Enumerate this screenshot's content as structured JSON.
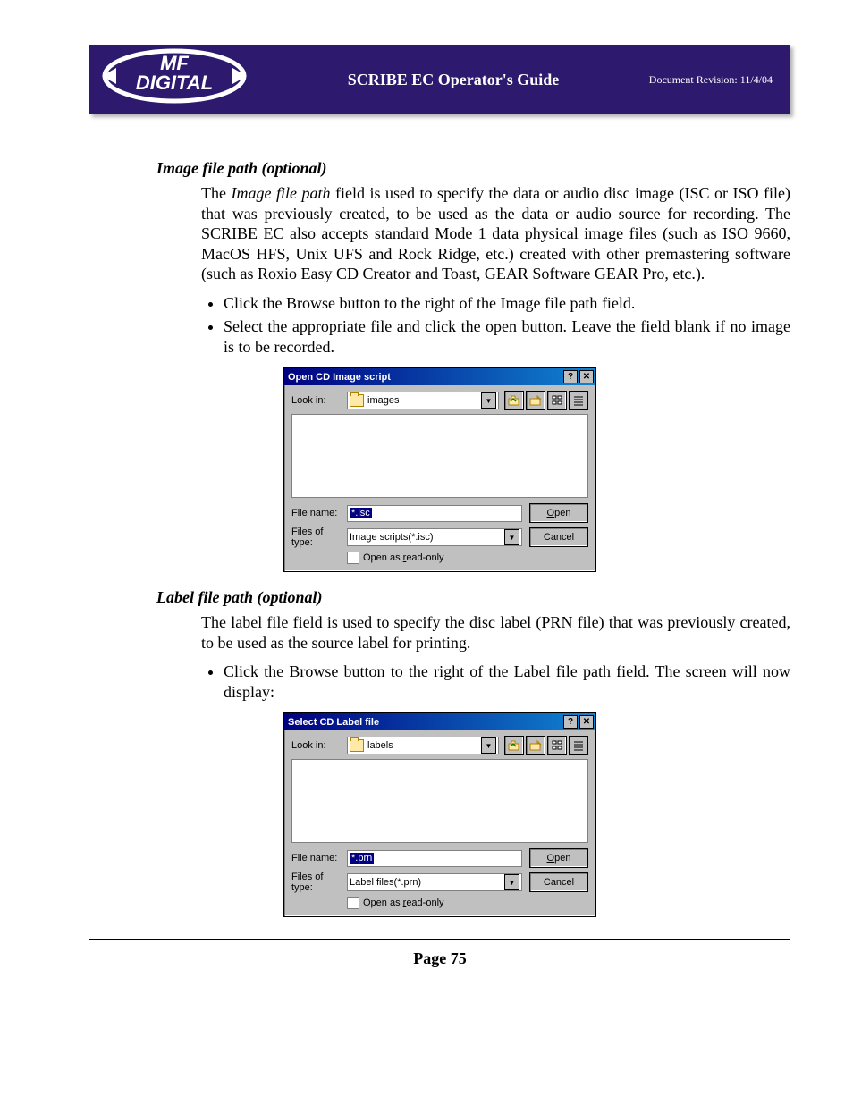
{
  "header": {
    "title": "SCRIBE EC Operator's Guide",
    "revision": "Document Revision: 11/4/04",
    "logo_text_top": "MF",
    "logo_text_bottom": "DIGITAL"
  },
  "section1": {
    "heading": "Image file path (optional)",
    "para_pre": "The ",
    "para_em1": "Image file path",
    "para_post": " field is used to specify the data or audio disc image (ISC or ISO file) that was previously created, to be used as the data or audio source for recording. The SCRIBE EC also accepts standard Mode 1 data physical image files (such as ISO 9660, MacOS HFS, Unix UFS and Rock Ridge, etc.) created with other premastering software (such as Roxio Easy CD Creator and Toast, GEAR Software GEAR Pro, etc.).",
    "bullet1_pre": "Click the ",
    "bullet1_em1": "Browse",
    "bullet1_mid": " button to the right of the ",
    "bullet1_em2": "Image file path",
    "bullet1_post": " field.",
    "bullet2": "Select the appropriate file and click the open button. Leave the field blank if no image is to be recorded."
  },
  "dialog1": {
    "title": "Open CD Image script",
    "lookin_label": "Look in:",
    "lookin_value": "images",
    "filename_label": "File name:",
    "filename_value": "*.isc",
    "filetype_label": "Files of type:",
    "filetype_value": "Image scripts(*.isc)",
    "open_btn": "Open",
    "open_ul": "O",
    "cancel_btn": "Cancel",
    "readonly_label": "Open as read-only",
    "readonly_ul": "r"
  },
  "section2": {
    "heading": "Label file path (optional)",
    "para": "The label file field is used to specify the disc label (PRN file) that was previously created, to be used as the source label for printing.",
    "bullet1_pre": "Click the ",
    "bullet1_em1": "Browse",
    "bullet1_mid": " button to the right of the ",
    "bullet1_em2": "Label file path",
    "bullet1_post": " field. The screen will now display:"
  },
  "dialog2": {
    "title": "Select CD Label file",
    "lookin_label": "Look in:",
    "lookin_value": "labels",
    "filename_label": "File name:",
    "filename_value": "*.prn",
    "filetype_label": "Files of type:",
    "filetype_value": "Label files(*.prn)",
    "open_btn": "Open",
    "open_ul": "O",
    "cancel_btn": "Cancel",
    "readonly_label": "Open as read-only",
    "readonly_ul": "r"
  },
  "footer": {
    "page": "Page 75"
  }
}
